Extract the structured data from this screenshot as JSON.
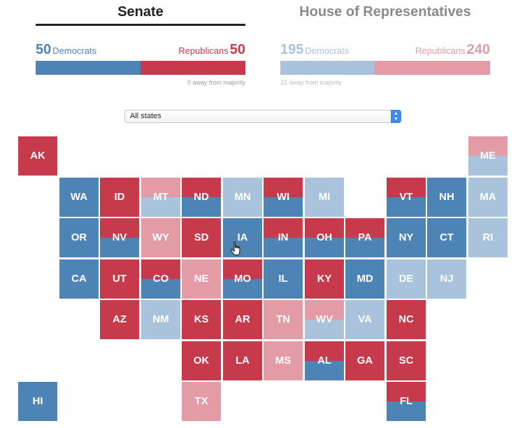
{
  "colors": {
    "dem": "#4e83b5",
    "rep": "#c63a4b",
    "dem_light": "#a9c3dc",
    "rep_light": "#e39ca6"
  },
  "senate": {
    "tab_label": "Senate",
    "dem_count": "50",
    "dem_label": "Democrats",
    "rep_label": "Republicans",
    "rep_count": "50",
    "dem_share": 0.5,
    "majority_note": "0 away from majority"
  },
  "house": {
    "tab_label": "House of Representatives",
    "dem_count": "195",
    "dem_label": "Democrats",
    "rep_label": "Republicans",
    "rep_count": "240",
    "dem_share": 0.448,
    "majority_note": "22 away from majority"
  },
  "filter": {
    "selected": "All states"
  },
  "states": [
    {
      "abbr": "AK",
      "row": 0,
      "col": 0,
      "top": "rep",
      "bottom": "rep"
    },
    {
      "abbr": "ME",
      "row": 0,
      "col": 11,
      "top": "rep_light",
      "bottom": "dem_light"
    },
    {
      "abbr": "WA",
      "row": 1,
      "col": 1,
      "top": "dem",
      "bottom": "dem"
    },
    {
      "abbr": "ID",
      "row": 1,
      "col": 2,
      "top": "rep",
      "bottom": "rep"
    },
    {
      "abbr": "MT",
      "row": 1,
      "col": 3,
      "top": "rep_light",
      "bottom": "dem_light"
    },
    {
      "abbr": "ND",
      "row": 1,
      "col": 4,
      "top": "rep",
      "bottom": "dem"
    },
    {
      "abbr": "MN",
      "row": 1,
      "col": 5,
      "top": "dem_light",
      "bottom": "dem_light"
    },
    {
      "abbr": "WI",
      "row": 1,
      "col": 6,
      "top": "rep",
      "bottom": "dem"
    },
    {
      "abbr": "MI",
      "row": 1,
      "col": 7,
      "top": "dem_light",
      "bottom": "dem_light"
    },
    {
      "abbr": "VT",
      "row": 1,
      "col": 9,
      "top": "rep",
      "bottom": "dem"
    },
    {
      "abbr": "NH",
      "row": 1,
      "col": 10,
      "top": "dem",
      "bottom": "dem"
    },
    {
      "abbr": "MA",
      "row": 1,
      "col": 11,
      "top": "dem_light",
      "bottom": "dem_light"
    },
    {
      "abbr": "OR",
      "row": 2,
      "col": 1,
      "top": "dem",
      "bottom": "dem"
    },
    {
      "abbr": "NV",
      "row": 2,
      "col": 2,
      "top": "rep",
      "bottom": "dem"
    },
    {
      "abbr": "WY",
      "row": 2,
      "col": 3,
      "top": "rep_light",
      "bottom": "rep_light"
    },
    {
      "abbr": "SD",
      "row": 2,
      "col": 4,
      "top": "rep",
      "bottom": "rep"
    },
    {
      "abbr": "IA",
      "row": 2,
      "col": 5,
      "top": "dem",
      "bottom": "dem"
    },
    {
      "abbr": "IN",
      "row": 2,
      "col": 6,
      "top": "rep",
      "bottom": "dem"
    },
    {
      "abbr": "OH",
      "row": 2,
      "col": 7,
      "top": "rep",
      "bottom": "dem"
    },
    {
      "abbr": "PA",
      "row": 2,
      "col": 8,
      "top": "rep",
      "bottom": "dem"
    },
    {
      "abbr": "NY",
      "row": 2,
      "col": 9,
      "top": "dem",
      "bottom": "dem"
    },
    {
      "abbr": "CT",
      "row": 2,
      "col": 10,
      "top": "dem",
      "bottom": "dem"
    },
    {
      "abbr": "RI",
      "row": 2,
      "col": 11,
      "top": "dem_light",
      "bottom": "dem_light"
    },
    {
      "abbr": "CA",
      "row": 3,
      "col": 1,
      "top": "dem",
      "bottom": "dem"
    },
    {
      "abbr": "UT",
      "row": 3,
      "col": 2,
      "top": "rep",
      "bottom": "rep"
    },
    {
      "abbr": "CO",
      "row": 3,
      "col": 3,
      "top": "rep",
      "bottom": "dem"
    },
    {
      "abbr": "NE",
      "row": 3,
      "col": 4,
      "top": "rep_light",
      "bottom": "rep_light"
    },
    {
      "abbr": "MO",
      "row": 3,
      "col": 5,
      "top": "rep",
      "bottom": "dem"
    },
    {
      "abbr": "IL",
      "row": 3,
      "col": 6,
      "top": "dem",
      "bottom": "dem"
    },
    {
      "abbr": "KY",
      "row": 3,
      "col": 7,
      "top": "rep",
      "bottom": "rep"
    },
    {
      "abbr": "MD",
      "row": 3,
      "col": 8,
      "top": "dem",
      "bottom": "dem"
    },
    {
      "abbr": "DE",
      "row": 3,
      "col": 9,
      "top": "dem_light",
      "bottom": "dem_light"
    },
    {
      "abbr": "NJ",
      "row": 3,
      "col": 10,
      "top": "dem_light",
      "bottom": "dem_light"
    },
    {
      "abbr": "AZ",
      "row": 4,
      "col": 2,
      "top": "rep",
      "bottom": "rep"
    },
    {
      "abbr": "NM",
      "row": 4,
      "col": 3,
      "top": "dem_light",
      "bottom": "dem_light"
    },
    {
      "abbr": "KS",
      "row": 4,
      "col": 4,
      "top": "rep",
      "bottom": "rep"
    },
    {
      "abbr": "AR",
      "row": 4,
      "col": 5,
      "top": "rep",
      "bottom": "rep"
    },
    {
      "abbr": "TN",
      "row": 4,
      "col": 6,
      "top": "rep_light",
      "bottom": "rep_light"
    },
    {
      "abbr": "WV",
      "row": 4,
      "col": 7,
      "top": "rep_light",
      "bottom": "dem_light"
    },
    {
      "abbr": "VA",
      "row": 4,
      "col": 8,
      "top": "dem_light",
      "bottom": "dem_light"
    },
    {
      "abbr": "NC",
      "row": 4,
      "col": 9,
      "top": "rep",
      "bottom": "rep"
    },
    {
      "abbr": "OK",
      "row": 5,
      "col": 4,
      "top": "rep",
      "bottom": "rep"
    },
    {
      "abbr": "LA",
      "row": 5,
      "col": 5,
      "top": "rep",
      "bottom": "rep"
    },
    {
      "abbr": "MS",
      "row": 5,
      "col": 6,
      "top": "rep_light",
      "bottom": "rep_light"
    },
    {
      "abbr": "AL",
      "row": 5,
      "col": 7,
      "top": "rep",
      "bottom": "dem"
    },
    {
      "abbr": "GA",
      "row": 5,
      "col": 8,
      "top": "rep",
      "bottom": "rep"
    },
    {
      "abbr": "SC",
      "row": 5,
      "col": 9,
      "top": "rep",
      "bottom": "rep"
    },
    {
      "abbr": "HI",
      "row": 6,
      "col": 0,
      "top": "dem",
      "bottom": "dem"
    },
    {
      "abbr": "TX",
      "row": 6,
      "col": 4,
      "top": "rep_light",
      "bottom": "rep_light"
    },
    {
      "abbr": "FL",
      "row": 6,
      "col": 9,
      "top": "rep",
      "bottom": "dem"
    }
  ]
}
